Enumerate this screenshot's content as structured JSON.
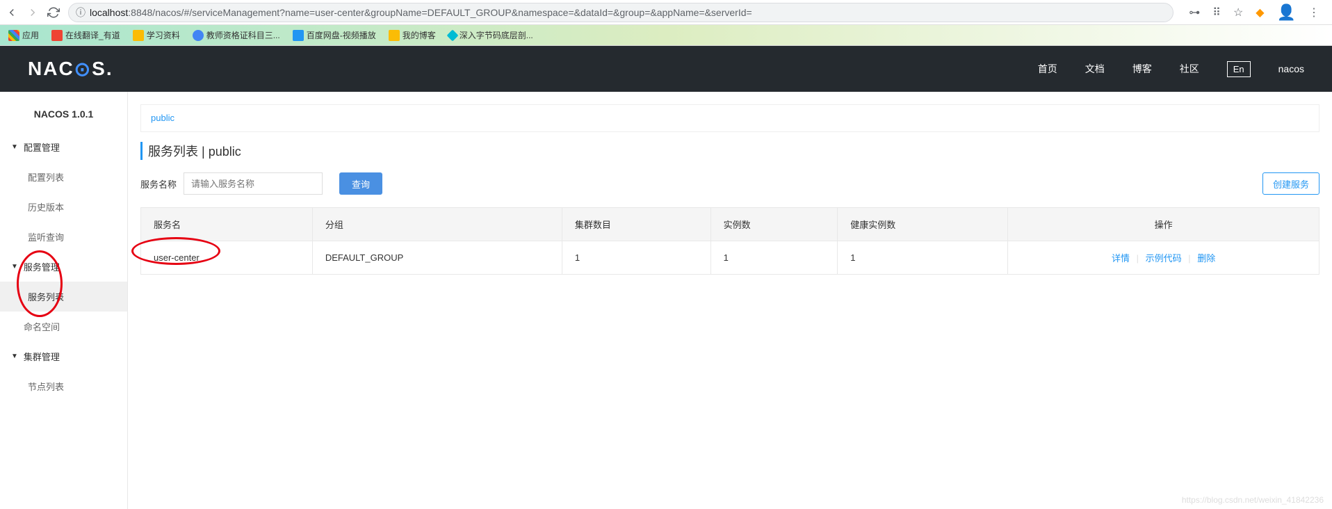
{
  "browser": {
    "url_host": "localhost",
    "url_path": ":8848/nacos/#/serviceManagement?name=user-center&groupName=DEFAULT_GROUP&namespace=&dataId=&group=&appName=&serverId="
  },
  "bookmarks": {
    "apps": "应用",
    "items": [
      "在线翻译_有道",
      "学习资料",
      "教师资格证科目三...",
      "百度网盘-视频播放",
      "我的博客",
      "深入字节码底层剖..."
    ]
  },
  "header": {
    "logo_left": "NAC",
    "logo_right": "S.",
    "nav": {
      "home": "首页",
      "docs": "文档",
      "blog": "博客",
      "community": "社区",
      "lang": "En",
      "user": "nacos"
    }
  },
  "sidebar": {
    "title": "NACOS 1.0.1",
    "groups": [
      {
        "label": "配置管理",
        "items": [
          "配置列表",
          "历史版本",
          "监听查询"
        ]
      },
      {
        "label": "服务管理",
        "items": [
          "服务列表"
        ]
      }
    ],
    "namespaces": "命名空间",
    "cluster": {
      "label": "集群管理",
      "items": [
        "节点列表"
      ]
    }
  },
  "content": {
    "tab_public": "public",
    "page_title": "服务列表",
    "page_title_sep": "  |  ",
    "page_title_ns": "public",
    "search_label": "服务名称",
    "search_placeholder": "请输入服务名称",
    "btn_query": "查询",
    "btn_create": "创建服务"
  },
  "table": {
    "headers": {
      "name": "服务名",
      "group": "分组",
      "clusters": "集群数目",
      "instances": "实例数",
      "healthy": "健康实例数",
      "actions": "操作"
    },
    "rows": [
      {
        "name": "user-center",
        "group": "DEFAULT_GROUP",
        "clusters": "1",
        "instances": "1",
        "healthy": "1"
      }
    ],
    "actions": {
      "detail": "详情",
      "sample": "示例代码",
      "delete": "删除"
    }
  },
  "watermark": "https://blog.csdn.net/weixin_41842236"
}
